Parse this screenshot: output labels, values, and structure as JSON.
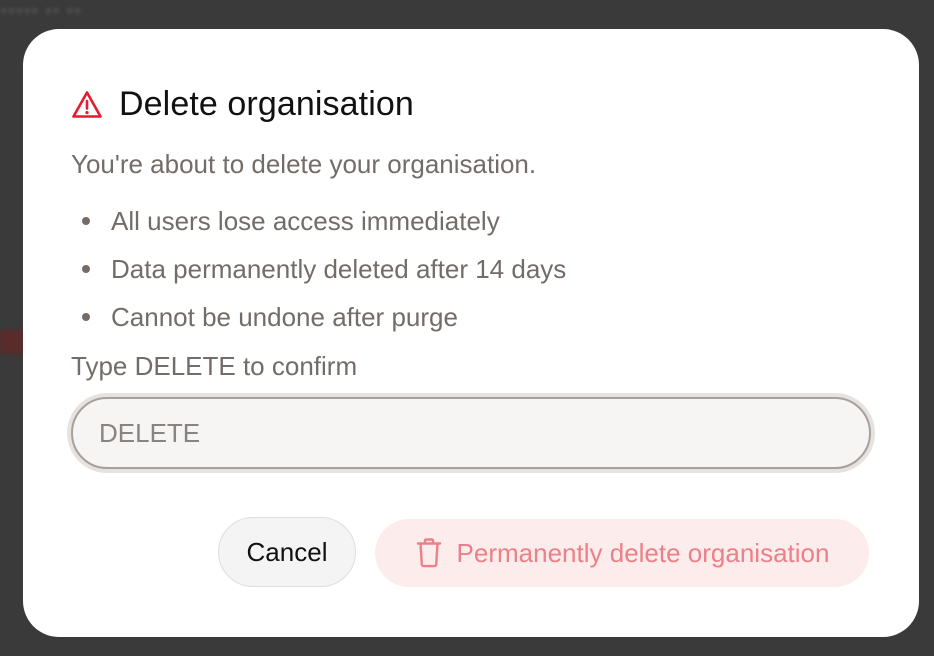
{
  "backdrop": {
    "partial_text": "••••• •• ••"
  },
  "dialog": {
    "title": "Delete organisation",
    "title_icon": "warning-triangle-icon",
    "intro": "You're about to delete your organisation.",
    "bullets": [
      "All users lose access immediately",
      "Data permanently deleted after 14 days",
      "Cannot be undone after purge"
    ],
    "confirm_label": "Type DELETE to confirm",
    "confirm_input": {
      "value": "",
      "placeholder": "DELETE"
    },
    "cancel_label": "Cancel",
    "delete_label": "Permanently delete organisation",
    "delete_icon": "trash-icon"
  },
  "colors": {
    "danger": "#e11d2e",
    "danger_disabled_text": "#ec8088",
    "danger_disabled_bg": "#fdecec",
    "muted_text": "#736c68",
    "overlay": "#3a3a3a"
  }
}
